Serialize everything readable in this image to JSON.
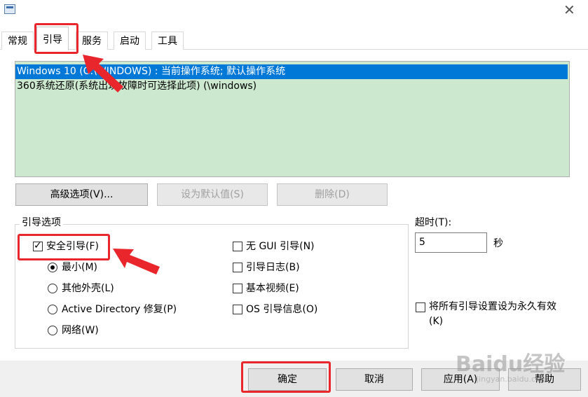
{
  "tabs": [
    {
      "id": "general",
      "label": "常规"
    },
    {
      "id": "boot",
      "label": "引导"
    },
    {
      "id": "services",
      "label": "服务"
    },
    {
      "id": "startup",
      "label": "启动"
    },
    {
      "id": "tools",
      "label": "工具"
    }
  ],
  "active_tab": "引导",
  "boot_list": [
    {
      "text": "Windows 10 (C:\\WINDOWS) : 当前操作系统; 默认操作系统",
      "selected": true
    },
    {
      "text": "360系统还原(系统出现故障时可选择此项) (\\windows)",
      "selected": false
    }
  ],
  "list_buttons": {
    "advanced": "高级选项(V)...",
    "set_default": "设为默认值(S)",
    "delete": "删除(D)"
  },
  "boot_options": {
    "legend": "引导选项",
    "safe_boot": "安全引导(F)",
    "minimal": "最小(M)",
    "alternate_shell": "其他外壳(L)",
    "ad_repair": "Active Directory 修复(P)",
    "network": "网络(W)",
    "no_gui": "无 GUI 引导(N)",
    "boot_log": "引导日志(B)",
    "base_video": "基本视频(E)",
    "os_info": "OS 引导信息(O)"
  },
  "timeout": {
    "label": "超时(T):",
    "value": "5",
    "unit": "秒"
  },
  "make_permanent": {
    "line1": "将所有引导设置设为永久有效",
    "line2": "(K)"
  },
  "footer_buttons": {
    "ok": "确定",
    "cancel": "取消",
    "apply": "应用(A)",
    "help": "帮助"
  },
  "watermark": {
    "text": "Baidu经验",
    "sub": "jingyan.baidu.com"
  },
  "colors": {
    "list_bg": "#cce8cf",
    "selection": "#0078d7",
    "annotation": "#e8262b"
  }
}
